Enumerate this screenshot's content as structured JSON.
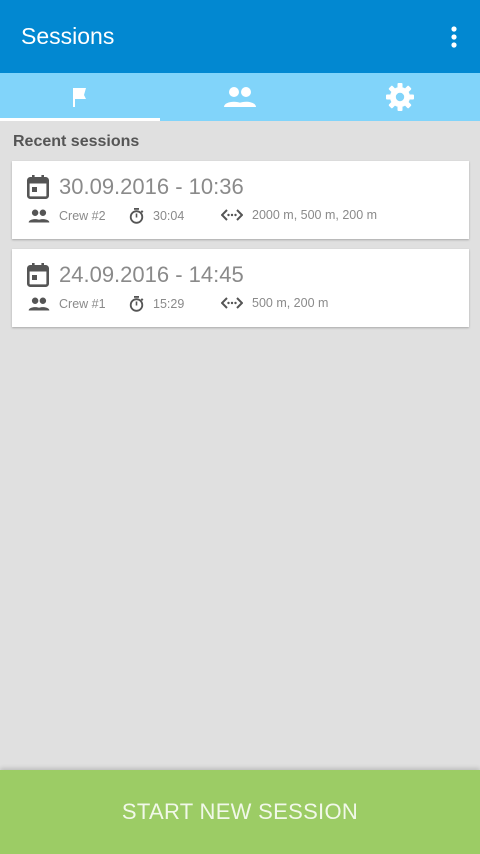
{
  "appbar": {
    "title": "Sessions",
    "menu_icon": "more-vert-icon"
  },
  "tabs": [
    {
      "icon": "flag-icon",
      "active": true
    },
    {
      "icon": "people-icon",
      "active": false
    },
    {
      "icon": "gear-icon",
      "active": false
    }
  ],
  "main": {
    "section_title": "Recent sessions",
    "sessions": [
      {
        "date": "30.09.2016 - 10:36",
        "crew": "Crew #2",
        "duration": "30:04",
        "distances": "2000 m, 500 m, 200 m"
      },
      {
        "date": "24.09.2016 - 14:45",
        "crew": "Crew #1",
        "duration": "15:29",
        "distances": "500 m, 200 m"
      }
    ]
  },
  "footer": {
    "start_label": "START NEW SESSION"
  },
  "colors": {
    "appbar": "#0288d1",
    "tabbar": "#81d4fa",
    "background": "#e0e0e0",
    "start_button": "#9ccc65",
    "card_text": "#8a8a8a",
    "card_icon": "#555555"
  }
}
